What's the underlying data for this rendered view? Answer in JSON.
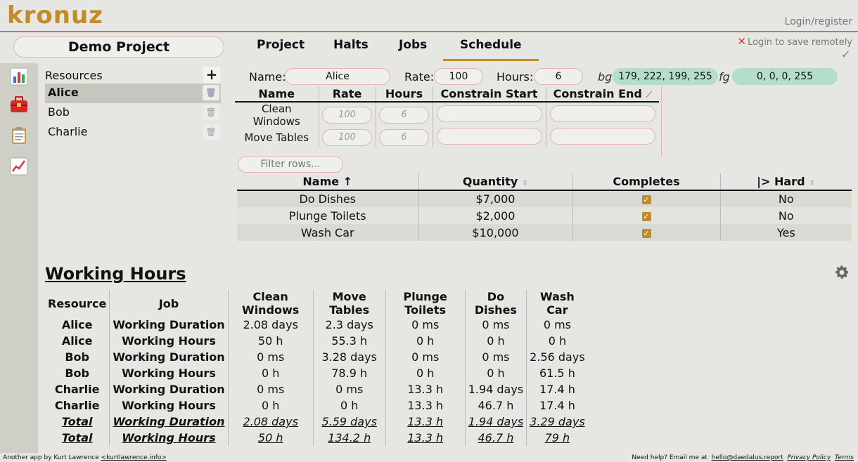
{
  "header": {
    "logo": "kronuz",
    "login": "Login/register"
  },
  "subbar": {
    "project_name": "Demo Project",
    "tabs": [
      "Project",
      "Halts",
      "Jobs",
      "Schedule"
    ],
    "save_msg": "Login to save remotely",
    "save_icon": "✕",
    "check_icon": "✓"
  },
  "resources": {
    "title": "Resources",
    "add": "+",
    "items": [
      "Alice",
      "Bob",
      "Charlie"
    ]
  },
  "editor": {
    "name_label": "Name:",
    "name_value": "Alice",
    "rate_label": "Rate:",
    "rate_value": "100",
    "hours_label": "Hours:",
    "hours_value": "6",
    "bg_label": "bg",
    "bg_value": "179, 222, 199, 255",
    "fg_label": "fg",
    "fg_value": "0, 0, 0, 255",
    "bg_color": "#b3dec7"
  },
  "constraints": {
    "headers": [
      "Name",
      "Rate",
      "Hours",
      "Constrain Start",
      "Constrain End"
    ],
    "rows": [
      {
        "name": "Clean Windows",
        "rate_placeholder": "100",
        "hours_placeholder": "6"
      },
      {
        "name": "Move Tables",
        "rate_placeholder": "100",
        "hours_placeholder": "6"
      }
    ]
  },
  "jobs_table": {
    "filter_placeholder": "Filter rows...",
    "headers": [
      "Name ↑",
      "Quantity",
      "Completes",
      "|> Hard"
    ],
    "rows": [
      {
        "name": "Do Dishes",
        "quantity": "$7,000",
        "hard": "No"
      },
      {
        "name": "Plunge Toilets",
        "quantity": "$2,000",
        "hard": "No"
      },
      {
        "name": "Wash Car",
        "quantity": "$10,000",
        "hard": "Yes"
      }
    ]
  },
  "working_hours": {
    "title": "Working Hours",
    "headers": [
      "Resource",
      "Job",
      "Clean Windows",
      "Move Tables",
      "Plunge Toilets",
      "Do Dishes",
      "Wash Car"
    ],
    "rows": [
      [
        "Alice",
        "Working Duration",
        "2.08 days",
        "2.3 days",
        "0 ms",
        "0 ms",
        "0 ms"
      ],
      [
        "Alice",
        "Working Hours",
        "50 h",
        "55.3 h",
        "0 h",
        "0 h",
        "0 h"
      ],
      [
        "Bob",
        "Working Duration",
        "0 ms",
        "3.28 days",
        "0 ms",
        "0 ms",
        "2.56 days"
      ],
      [
        "Bob",
        "Working Hours",
        "0 h",
        "78.9 h",
        "0 h",
        "0 h",
        "61.5 h"
      ],
      [
        "Charlie",
        "Working Duration",
        "0 ms",
        "0 ms",
        "13.3 h",
        "1.94 days",
        "17.4 h"
      ],
      [
        "Charlie",
        "Working Hours",
        "0 h",
        "0 h",
        "13.3 h",
        "46.7 h",
        "17.4 h"
      ],
      [
        "Total",
        "Working Duration",
        "2.08 days",
        "5.59 days",
        "13.3 h",
        "1.94 days",
        "3.29 days"
      ],
      [
        "Total",
        "Working Hours",
        "50 h",
        "134.2 h",
        "13.3 h",
        "46.7 h",
        "79 h"
      ]
    ]
  },
  "footer": {
    "left_text": "Another app by Kurt Lawrence",
    "left_link": "<kurtlawrence.info>",
    "help_text": "Need help? Email me at",
    "email": "hello@daedalus.report",
    "privacy": "Privacy Policy",
    "terms": "Terms"
  }
}
